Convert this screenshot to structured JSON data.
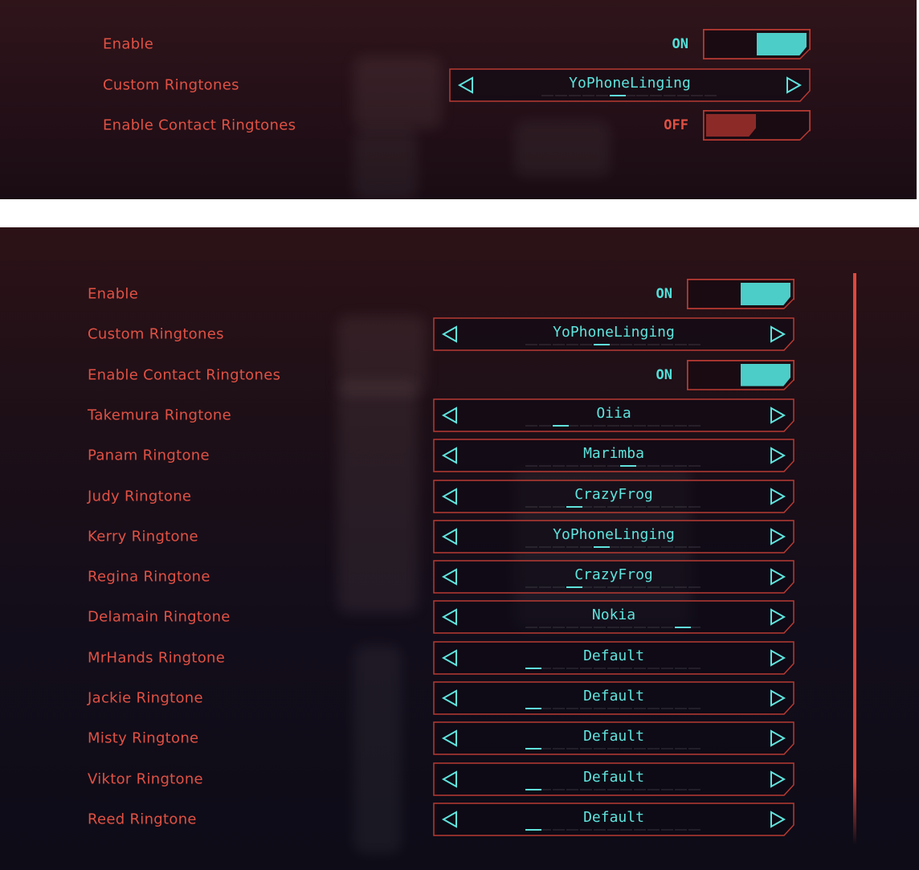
{
  "top_panel": {
    "rows": [
      {
        "label": "Enable",
        "kind": "toggle",
        "state": "ON",
        "on": true
      },
      {
        "label": "Custom Ringtones",
        "kind": "selector",
        "value": "YoPhoneLinging",
        "index": 5,
        "count": 13
      },
      {
        "label": "Enable Contact Ringtones",
        "kind": "toggle",
        "state": "OFF",
        "on": false
      }
    ]
  },
  "bottom_panel": {
    "rows": [
      {
        "label": "Enable",
        "kind": "toggle",
        "state": "ON",
        "on": true
      },
      {
        "label": "Custom Ringtones",
        "kind": "selector",
        "value": "YoPhoneLinging",
        "index": 5,
        "count": 13
      },
      {
        "label": "Enable Contact Ringtones",
        "kind": "toggle",
        "state": "ON",
        "on": true
      },
      {
        "label": "Takemura Ringtone",
        "kind": "selector",
        "value": "Oiia",
        "index": 2,
        "count": 13
      },
      {
        "label": "Panam Ringtone",
        "kind": "selector",
        "value": "Marimba",
        "index": 7,
        "count": 13
      },
      {
        "label": "Judy Ringtone",
        "kind": "selector",
        "value": "CrazyFrog",
        "index": 3,
        "count": 13
      },
      {
        "label": "Kerry Ringtone",
        "kind": "selector",
        "value": "YoPhoneLinging",
        "index": 5,
        "count": 13
      },
      {
        "label": "Regina Ringtone",
        "kind": "selector",
        "value": "CrazyFrog",
        "index": 3,
        "count": 13
      },
      {
        "label": "Delamain Ringtone",
        "kind": "selector",
        "value": "Nokia",
        "index": 11,
        "count": 13
      },
      {
        "label": "MrHands Ringtone",
        "kind": "selector",
        "value": "Default",
        "index": 0,
        "count": 13
      },
      {
        "label": "Jackie Ringtone",
        "kind": "selector",
        "value": "Default",
        "index": 0,
        "count": 13
      },
      {
        "label": "Misty Ringtone",
        "kind": "selector",
        "value": "Default",
        "index": 0,
        "count": 13
      },
      {
        "label": "Viktor Ringtone",
        "kind": "selector",
        "value": "Default",
        "index": 0,
        "count": 13
      },
      {
        "label": "Reed Ringtone",
        "kind": "selector",
        "value": "Default",
        "index": 0,
        "count": 13
      }
    ]
  },
  "icons": {
    "prev": "triangle-left-icon",
    "next": "triangle-right-icon"
  },
  "colors": {
    "label_red": "#e05144",
    "accent_cyan": "#5fe3dc",
    "toggle_on": "#4dcdc8",
    "toggle_off": "#8c2a28",
    "frame_red": "#b83a33"
  }
}
